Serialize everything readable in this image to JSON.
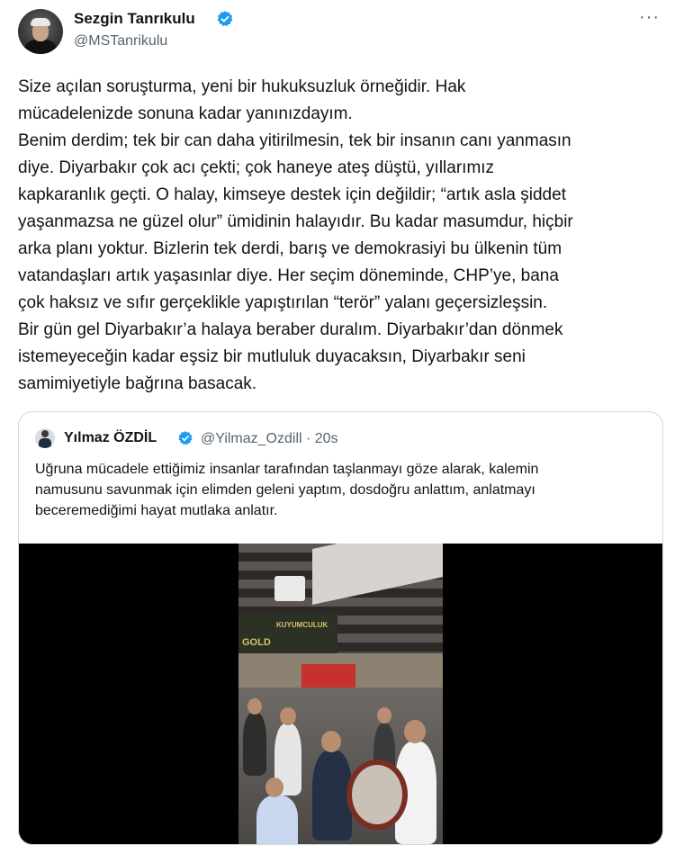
{
  "author": {
    "name": "Sezgin Tanrıkulu",
    "handle": "@MSTanrikulu",
    "verified_icon": "verified-badge-icon",
    "verified_color": "#1d9bf0"
  },
  "menu": {
    "more_label": "···"
  },
  "tweet": {
    "lines": [
      "Size açılan soruşturma, yeni bir hukuksuzluk örneğidir. Hak",
      "mücadelenizde sonuna kadar yanınızdayım.",
      "Benim derdim; tek bir can daha yitirilmesin, tek bir insanın canı yanmasın",
      "diye. Diyarbakır çok acı çekti; çok haneye ateş düştü, yıllarımız",
      "kapkaranlık geçti. O halay, kimseye destek için değildir; “artık asla şiddet",
      "yaşanmazsa ne güzel olur” ümidinin halayıdır. Bu kadar masumdur, hiçbir",
      "arka planı yoktur. Bizlerin tek derdi, barış ve demokrasiyi bu ülkenin tüm",
      "vatandaşları artık yaşasınlar diye. Her seçim döneminde, CHP’ye, bana",
      "çok haksız ve sıfır gerçeklikle yapıştırılan “terör” yalanı geçersizleşsin.",
      "Bir gün gel Diyarbakır’a halaya beraber duralım. Diyarbakır’dan dönmek",
      "istemeyeceğin kadar eşsiz bir mutluluk duyacaksın, Diyarbakır seni",
      "samimiyetiyle bağrına basacak."
    ]
  },
  "quoted": {
    "name": "Yılmaz ÖZDİL",
    "handle_time": "@Yilmaz_Ozdill · 20s",
    "lines": [
      "Uğruna mücadele ettiğimiz insanlar tarafından taşlanmayı göze alarak, kalemin",
      "namusunu savunmak için elimden geleni yaptım, dosdoğru anlattım, anlatmayı",
      "beceremediğimi hayat mutlaka anlatır."
    ],
    "video_sign_left": "GOLD",
    "video_sign_right": "KUYUMCULUK"
  }
}
